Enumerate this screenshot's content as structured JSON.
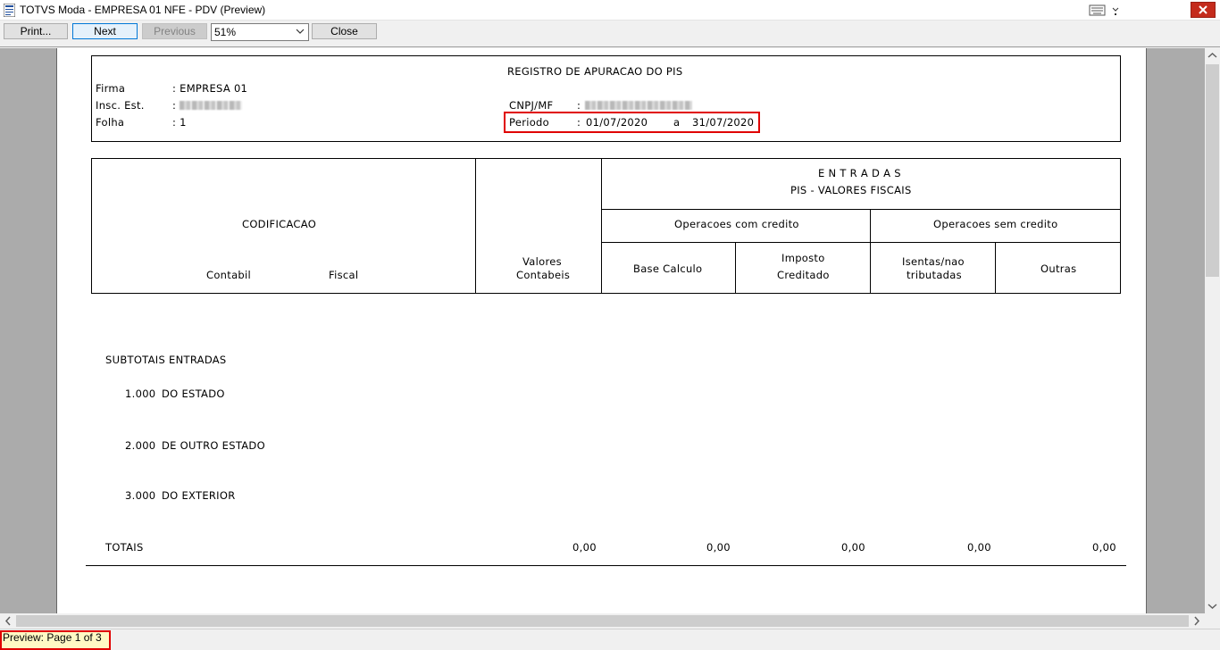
{
  "window": {
    "title": "TOTVS Moda - EMPRESA 01 NFE - PDV (Preview)"
  },
  "toolbar": {
    "print_label": "Print...",
    "next_label": "Next",
    "previous_label": "Previous",
    "zoom_value": "51%",
    "close_label": "Close"
  },
  "report": {
    "title": "REGISTRO DE APURACAO DO PIS",
    "firma_label": "Firma",
    "firma_value": ": EMPRESA 01",
    "insc_label": "Insc. Est.",
    "insc_sep": ":",
    "folha_label": "Folha",
    "folha_value": ": 1",
    "cnpj_label": "CNPJ/MF",
    "cnpj_sep": ":",
    "periodo_label": "Periodo",
    "periodo_sep": ":",
    "periodo_start": "01/07/2020",
    "periodo_a": "a",
    "periodo_end": "31/07/2020",
    "header": {
      "codificacao": "CODIFICACAO",
      "contabil": "Contabil",
      "fiscal": "Fiscal",
      "valores_1": "Valores",
      "valores_2": "Contabeis",
      "entradas": "E N T R A D A S",
      "pis_valores": "PIS  -  VALORES FISCAIS",
      "op_com": "Operacoes com credito",
      "op_sem": "Operacoes sem credito",
      "base_calculo": "Base Calculo",
      "imposto_1": "Imposto",
      "imposto_2": "Creditado",
      "isentas_1": "Isentas/nao",
      "isentas_2": "tributadas",
      "outras": "Outras"
    },
    "subtotais": "SUBTOTAIS ENTRADAS",
    "rows": [
      {
        "code": "1.000",
        "label": "DO ESTADO"
      },
      {
        "code": "2.000",
        "label": "DE OUTRO ESTADO"
      },
      {
        "code": "3.000",
        "label": "DO EXTERIOR"
      }
    ],
    "totais_label": "TOTAIS",
    "totais_values": [
      "0,00",
      "0,00",
      "0,00",
      "0,00",
      "0,00"
    ]
  },
  "status": {
    "text": "Preview: Page 1 of 3"
  },
  "colors": {
    "highlight": "#e00000",
    "status_bg": "#fff9c4",
    "accent": "#0078d7"
  }
}
